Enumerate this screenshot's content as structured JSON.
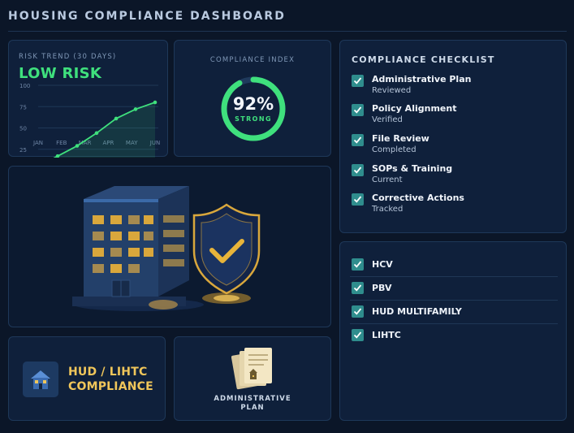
{
  "header": {
    "title": "HOUSING COMPLIANCE DASHBOARD"
  },
  "risk_trend": {
    "label": "RISK TREND (30 DAYS)",
    "status": "LOW RISK",
    "status_color": "#3fe07d"
  },
  "chart_data": {
    "type": "area",
    "categories": [
      "JAN",
      "FEB",
      "MAR",
      "APR",
      "MAY",
      "JUN"
    ],
    "y_ticks": [
      "100",
      "75",
      "50",
      "25"
    ],
    "ylim": [
      0,
      100
    ],
    "series": [
      {
        "values": [
          5,
          17,
          29,
          44,
          61,
          72,
          80
        ]
      }
    ],
    "grid": true,
    "line_color": "#3fe07d"
  },
  "compliance_index": {
    "label": "COMPLIANCE INDEX",
    "value_text": "92%",
    "value": 0.92,
    "status": "STRONG"
  },
  "checklist": {
    "title": "COMPLIANCE CHECKLIST",
    "items": [
      {
        "title": "Administrative Plan",
        "sub": "Reviewed"
      },
      {
        "title": "Policy Alignment",
        "sub": "Verified"
      },
      {
        "title": "File Review",
        "sub": "Completed"
      },
      {
        "title": "SOPs & Training",
        "sub": "Current"
      },
      {
        "title": "Corrective Actions",
        "sub": "Tracked"
      }
    ]
  },
  "programs": {
    "items": [
      {
        "label": "HCV"
      },
      {
        "label": "PBV"
      },
      {
        "label": "HUD MULTIFAMILY"
      },
      {
        "label": "LIHTC"
      }
    ]
  },
  "hud_card": {
    "line1": "HUD / LIHTC",
    "line2": "COMPLIANCE"
  },
  "admin_card": {
    "line1": "ADMINISTRATIVE",
    "line2": "PLAN"
  },
  "colors": {
    "accent_green": "#3fe07d",
    "accent_gold": "#f0c65a",
    "checkbox": "#2f8d8d",
    "background": "#0b1628"
  }
}
